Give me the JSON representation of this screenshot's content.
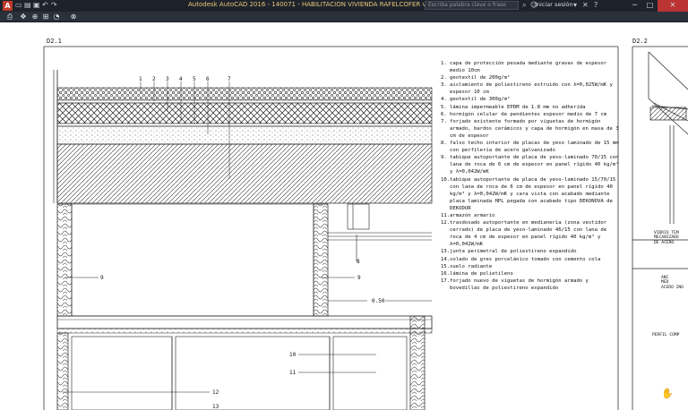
{
  "titlebar": {
    "app_title": "Autodesk AutoCAD 2016 - 140071 - HABILITACION VIVIENDA RAFELCOFER v7.dwg",
    "search_placeholder": "Escriba palabra clave o frase",
    "login_label": "Iniciar sesión"
  },
  "drawing": {
    "detail_left_label": "D2.1",
    "detail_right_label": "D2.2",
    "layer_numbers": [
      "1",
      "2",
      "3",
      "4",
      "5",
      "6",
      "7"
    ],
    "callouts": {
      "nine_left": "9",
      "nine_right": "9",
      "eight": "8",
      "dimension": "0.50",
      "ten": "10",
      "eleven": "11",
      "twelve": "12",
      "thirteen": "13"
    },
    "legend": [
      {
        "num": "1.",
        "text": "capa de protección pesada mediante gravas de espesor medio 10cm"
      },
      {
        "num": "2.",
        "text": "geotextil de 200g/m²"
      },
      {
        "num": "3.",
        "text": "aislamiento de poliestireno extruido con λ=0,025W/mK y espesor 10 cm"
      },
      {
        "num": "4.",
        "text": "geotextil de 300g/m²"
      },
      {
        "num": "5.",
        "text": "lámina impermeable EPDM de 1.8 mm no adherida"
      },
      {
        "num": "6.",
        "text": "hormigón celular de pendientes espesor medio de 7 cm"
      },
      {
        "num": "7.",
        "text": "forjado existente formado por viguetas de hormigón armado, bardos cerámicos y capa de hormigón en masa de 3 cm de espesor"
      },
      {
        "num": "8.",
        "text": "falso techo interior de placas de yeso laminado de 15 mm con perfilería de acero galvanizado"
      },
      {
        "num": "9.",
        "text": "tabique autoportante de placa de yeso-laminado 70/15 con lana de roca de 6 cm de espesor en panel rígido 40 kg/m³ y λ=0,042W/mK"
      },
      {
        "num": "10.",
        "text": "tabique autoportante de placa de yeso-laminado 15/70/15 con lana de roca de 6 cm de espesor en panel rígido 40 kg/m³ y λ=0,042W/mK y cara vista con acabado mediante placa laminada HPL pegada con acabado tipo DEKONOVA de DEKODUR"
      },
      {
        "num": "11.",
        "text": "armazón armario"
      },
      {
        "num": "12.",
        "text": "trasdosado autoportante en medianería (zona vestidor cerrado) de placa de yeso-laminado 46/15 con lana de roca de 4 cm de espesor en panel rígido 40 kg/m³ y λ=0,042W/mK"
      },
      {
        "num": "13.",
        "text": "junta perimetral de poliestireno expandido"
      },
      {
        "num": "14.",
        "text": "solado de gres porcelánico tomado con cemento cola"
      },
      {
        "num": "15.",
        "text": "suelo radiante"
      },
      {
        "num": "16.",
        "text": "lámina de polietileno"
      },
      {
        "num": "17.",
        "text": "forjado nuevo de viguetas de hormigón armado y bovedillas de poliestireno expandido"
      }
    ],
    "right_notes": {
      "vidrio": [
        "VIDRIO TEM",
        "MECANIZADO",
        "DE ACERO"
      ],
      "anclaje": [
        "ANC",
        "MED",
        "ACERO INO"
      ],
      "perfil": "PERFIL COMP"
    }
  }
}
